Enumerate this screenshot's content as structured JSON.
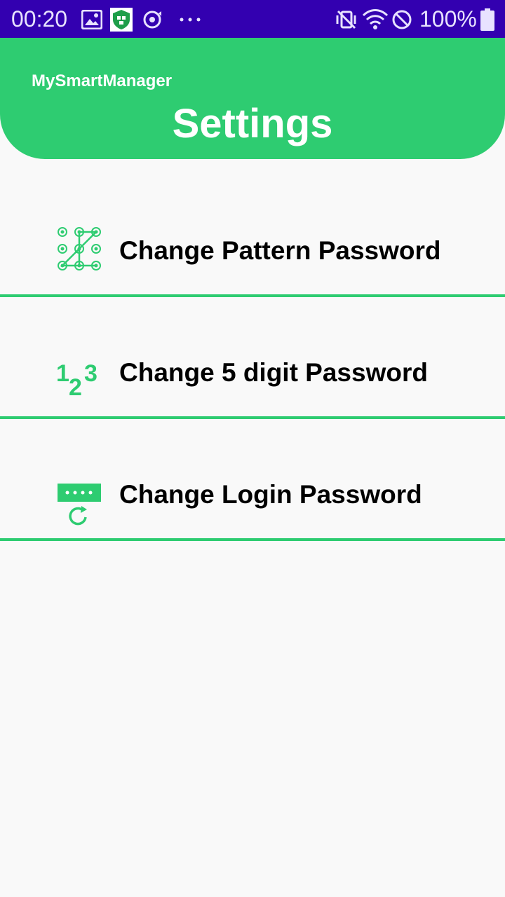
{
  "status_bar": {
    "time": "00:20",
    "battery_percent": "100%",
    "icons": [
      "image-icon",
      "shield-app-icon",
      "sync-icon",
      "more-dots-icon",
      "mute-vibrate-icon",
      "wifi-icon",
      "do-not-disturb-icon",
      "battery-icon"
    ],
    "background_color": "#3300b0"
  },
  "header": {
    "app_name": "MySmartManager",
    "title": "Settings",
    "background_color": "#2ecc71"
  },
  "menu": {
    "items": [
      {
        "label": "Change Pattern Password",
        "icon": "pattern-lock-icon"
      },
      {
        "label": "Change 5 digit Password",
        "icon": "numeric-123-icon"
      },
      {
        "label": "Change Login Password",
        "icon": "password-reset-icon"
      }
    ],
    "divider_color": "#2ecc71"
  }
}
